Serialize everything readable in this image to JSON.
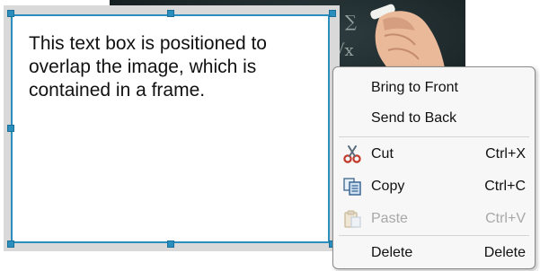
{
  "text_box": {
    "content": "This text box is positioned to overlap the image, which is contained in a frame."
  },
  "context_menu": {
    "items": [
      {
        "label": "Bring to Front",
        "shortcut": "",
        "icon": "",
        "enabled": true
      },
      {
        "label": "Send to Back",
        "shortcut": "",
        "icon": "",
        "enabled": true
      },
      {
        "label": "Cut",
        "shortcut": "Ctrl+X",
        "icon": "scissors-icon",
        "enabled": true
      },
      {
        "label": "Copy",
        "shortcut": "Ctrl+C",
        "icon": "copy-icon",
        "enabled": true
      },
      {
        "label": "Paste",
        "shortcut": "Ctrl+V",
        "icon": "paste-icon",
        "enabled": false
      },
      {
        "label": "Delete",
        "shortcut": "Delete",
        "icon": "",
        "enabled": true
      }
    ]
  },
  "colors": {
    "frame_border": "#2a8fbf",
    "handle": "#2a8fbf",
    "menu_background": "#f7f7f7",
    "disabled_text": "#a8a8a8"
  }
}
